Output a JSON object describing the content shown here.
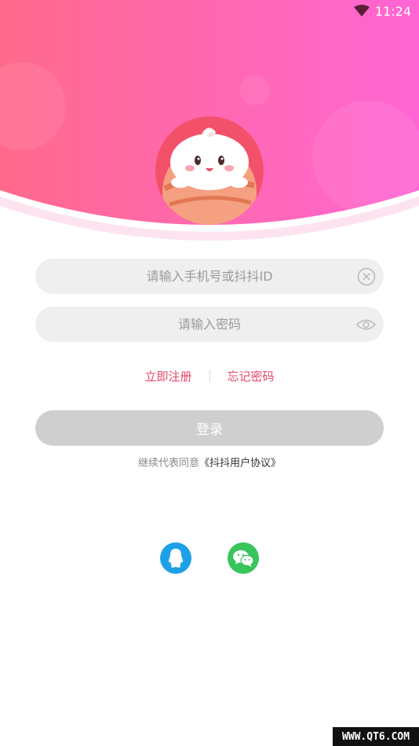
{
  "status_bar": {
    "time": "11:24",
    "wifi_icon": "wifi-icon"
  },
  "colors": {
    "header_start": "#ff6a8c",
    "header_end": "#ff66d4",
    "accent": "#e8476a",
    "input_bg": "#efefef",
    "button_disabled": "#cfcfcf",
    "qq": "#1da1e6",
    "wechat": "#39c45c"
  },
  "form": {
    "account_placeholder": "请输入手机号或抖抖ID",
    "password_placeholder": "请输入密码",
    "clear_icon": "clear-icon",
    "visibility_icon": "eye-icon"
  },
  "links": {
    "register": "立即注册",
    "forgot": "忘记密码"
  },
  "login_button": "登录",
  "agreement": {
    "prefix": "继续代表同意",
    "link": "《抖抖用户协议》"
  },
  "social": [
    {
      "name": "qq-login",
      "icon": "qq-icon"
    },
    {
      "name": "wechat-login",
      "icon": "wechat-icon"
    }
  ],
  "watermark": "WWW.QT6.COM"
}
